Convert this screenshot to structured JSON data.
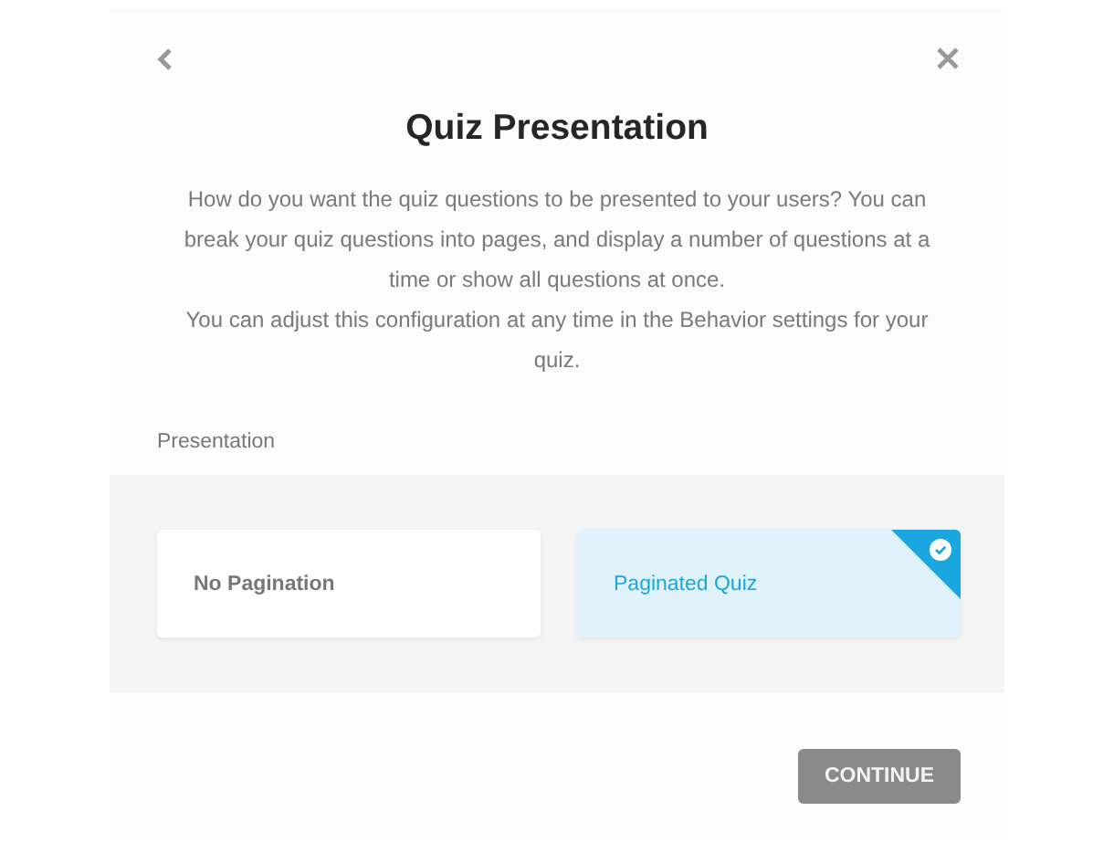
{
  "dialog": {
    "title": "Quiz Presentation",
    "description": [
      "How do you want the quiz questions to be presented to your users? You can break your quiz questions into pages, and display a number of questions at a time or show all questions at once.",
      "You can adjust this configuration at any time in the Behavior settings for your quiz."
    ],
    "section_label": "Presentation",
    "options": [
      {
        "label": "No Pagination",
        "selected": false
      },
      {
        "label": "Paginated Quiz",
        "selected": true
      }
    ],
    "continue_button": "CONTINUE"
  }
}
